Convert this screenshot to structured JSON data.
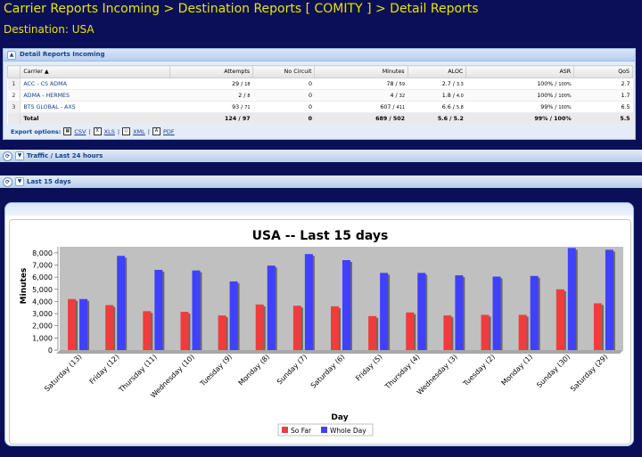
{
  "breadcrumb": "Carrier Reports Incoming > Destination Reports [ COMITY ] > Detail Reports",
  "destination": "Destination: USA",
  "detail_panel": {
    "title": "Detail Reports Incoming",
    "columns": [
      "",
      "Carrier",
      "Attempts",
      "No Circuit",
      "Minutes",
      "ALOC",
      "ASR",
      "QoS"
    ],
    "rows": [
      {
        "num": "1",
        "carrier": "ACC - CS ADMA",
        "att_a": "29",
        "att_b": "18",
        "nocirc": "0",
        "min_a": "78",
        "min_b": "59",
        "aloc_a": "2.7",
        "aloc_b": "3.3",
        "asr_a": "100%",
        "asr_b": "100%",
        "qos": "2.7"
      },
      {
        "num": "2",
        "carrier": "ADMA - HERMES",
        "att_a": "2",
        "att_b": "8",
        "nocirc": "0",
        "min_a": "4",
        "min_b": "32",
        "aloc_a": "1.8",
        "aloc_b": "4.0",
        "asr_a": "100%",
        "asr_b": "100%",
        "qos": "1.7"
      },
      {
        "num": "3",
        "carrier": "BTS GLOBAL - AXS",
        "att_a": "93",
        "att_b": "71",
        "nocirc": "0",
        "min_a": "607",
        "min_b": "411",
        "aloc_a": "6.6",
        "aloc_b": "5.8",
        "asr_a": "99%",
        "asr_b": "100%",
        "qos": "6.5"
      }
    ],
    "total": {
      "label": "Total",
      "attempts": "124 / 97",
      "nocirc": "0",
      "minutes": "689 / 502",
      "aloc": "5.6 / 5.2",
      "asr": "99% / 100%",
      "qos": "5.5"
    },
    "export": {
      "label": "Export options:",
      "csv": "CSV",
      "xls": "XLS",
      "xml": "XML",
      "pdf": "PDF"
    }
  },
  "traffic_bar": {
    "title": "Traffic / Last 24 hours"
  },
  "days_bar": {
    "title": "Last 15 days"
  },
  "colors": {
    "so_far": "#f03c3c",
    "whole_day": "#4040ff",
    "plot_bg": "#c0c0c0"
  },
  "chart_data": {
    "type": "bar",
    "title": "USA -- Last 15 days",
    "xlabel": "Day",
    "ylabel": "Minutes",
    "ylim": [
      0,
      8500
    ],
    "yticks": [
      "0",
      "1,000",
      "2,000",
      "3,000",
      "4,000",
      "5,000",
      "6,000",
      "7,000",
      "8,000"
    ],
    "ytick_values": [
      0,
      1000,
      2000,
      3000,
      4000,
      5000,
      6000,
      7000,
      8000
    ],
    "categories": [
      "Saturday (13)",
      "Friday (12)",
      "Thursday (11)",
      "Wednesday (10)",
      "Tuesday (9)",
      "Monday (8)",
      "Sunday (7)",
      "Saturday (6)",
      "Friday (5)",
      "Thursday (4)",
      "Wednesday (3)",
      "Tuesday (2)",
      "Monday (1)",
      "Sunday (30)",
      "Saturday (29)"
    ],
    "series": [
      {
        "name": "So Far",
        "values": [
          4200,
          3700,
          3200,
          3150,
          2850,
          3750,
          3650,
          3600,
          2800,
          3100,
          2850,
          2900,
          2900,
          5000,
          3850
        ]
      },
      {
        "name": "Whole Day",
        "values": [
          4200,
          7750,
          6600,
          6550,
          5650,
          6950,
          7900,
          7400,
          6350,
          6350,
          6150,
          6050,
          6100,
          8400,
          8250
        ]
      }
    ],
    "legend_position": "bottom-center",
    "grid": false
  }
}
